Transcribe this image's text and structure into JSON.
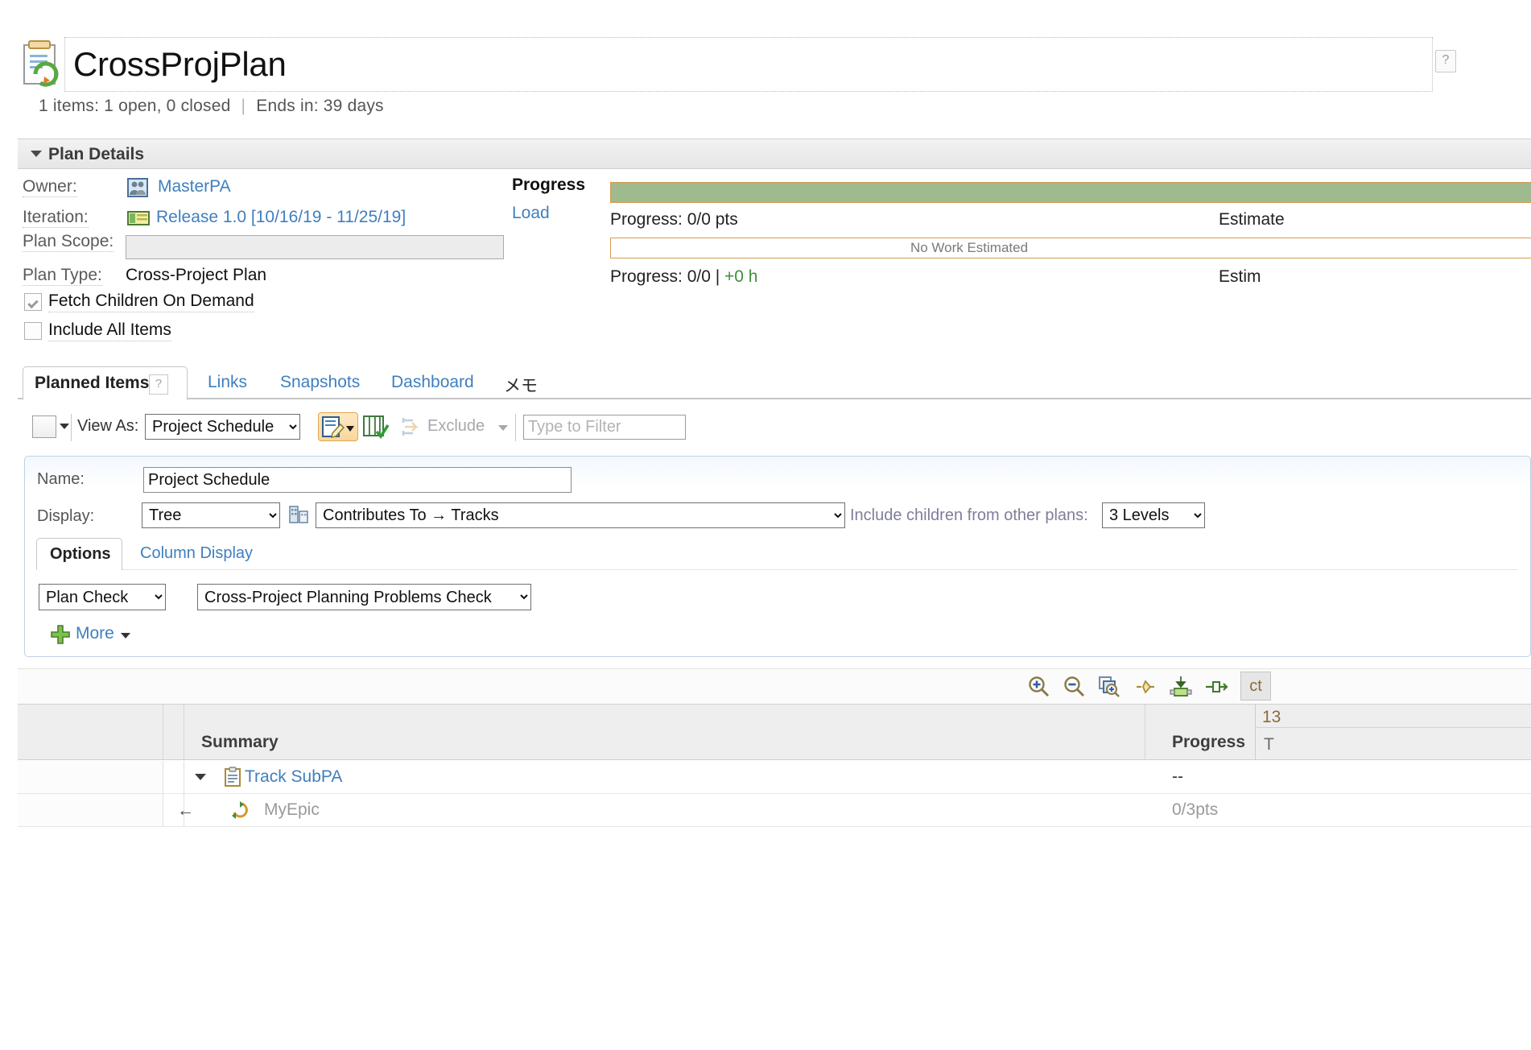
{
  "header": {
    "title": "CrossProjPlan",
    "help_badge": "?",
    "summary_items": "1 items:",
    "summary_open_closed": "1 open, 0 closed",
    "summary_sep": "|",
    "summary_ends": "Ends in:",
    "summary_days": "39 days"
  },
  "plan_details": {
    "section_label": "Plan Details",
    "owner_label": "Owner:",
    "owner_value": "MasterPA",
    "iteration_label": "Iteration:",
    "iteration_value": "Release 1.0 [10/16/19 - 11/25/19]",
    "scope_label": "Plan Scope:",
    "scope_value": "",
    "type_label": "Plan Type:",
    "type_value": "Cross-Project Plan",
    "fetch_children_label": "Fetch Children On Demand",
    "fetch_children_checked": true,
    "include_all_label": "Include All Items",
    "include_all_checked": false
  },
  "progress": {
    "title": "Progress",
    "load_link": "Load",
    "bar1_fill_pct": 100,
    "bar1_color": "#9fba8f",
    "bar1_border": "#d59b4e",
    "row1_progress": "Progress: 0/0 pts",
    "row1_estimate": "Estimate",
    "bar2_text": "No Work Estimated",
    "row2_progress_prefix": "Progress: 0/0 |",
    "row2_progress_hours": "+0 h",
    "row2_estimate": "Estim"
  },
  "tabs": {
    "main": "Planned Items",
    "main_help": "?",
    "others": [
      "Links",
      "Snapshots",
      "Dashboard",
      "メモ"
    ]
  },
  "toolbar": {
    "view_as_label": "View As:",
    "view_as_value": "Project Schedule",
    "view_as_options": [
      "Project Schedule"
    ],
    "exclude_label": "Exclude",
    "filter_placeholder": "Type to Filter",
    "filter_value": ""
  },
  "view_editor": {
    "name_label": "Name:",
    "name_value": "Project Schedule",
    "display_label": "Display:",
    "display_value": "Tree",
    "display_options": [
      "Tree"
    ],
    "contributes_value": "Contributes To → Tracks",
    "contributes_options": [
      "Contributes To → Tracks"
    ],
    "include_children_label": "Include children from other plans:",
    "levels_value": "3 Levels",
    "levels_options": [
      "3 Levels"
    ],
    "options_tab": "Options",
    "column_display_tab": "Column Display",
    "plan_check_value": "Plan Check",
    "plan_check_options": [
      "Plan Check"
    ],
    "problems_check_value": "Cross-Project Planning Problems Check",
    "problems_check_options": [
      "Cross-Project Planning Problems Check"
    ],
    "more_label": "More"
  },
  "grid_toolbar": {
    "icons": [
      "zoom-in-icon",
      "zoom-out-icon",
      "zoom-fit-icon",
      "collapse-icon",
      "export-icon",
      "expand-width-icon"
    ],
    "ct_label": "ct"
  },
  "grid": {
    "columns": [
      "",
      "",
      "Summary",
      "Progress"
    ],
    "right_header_top": "13",
    "right_header_sub": "T",
    "rows": [
      {
        "summary": "Track SubPA",
        "icon": "clipboard-icon",
        "progress": "--",
        "expanded": true,
        "indent": 0,
        "link": true
      },
      {
        "summary": "MyEpic",
        "icon": "epic-refresh-icon",
        "progress": "0/3pts",
        "expanded": false,
        "indent": 1,
        "link": false
      }
    ]
  }
}
